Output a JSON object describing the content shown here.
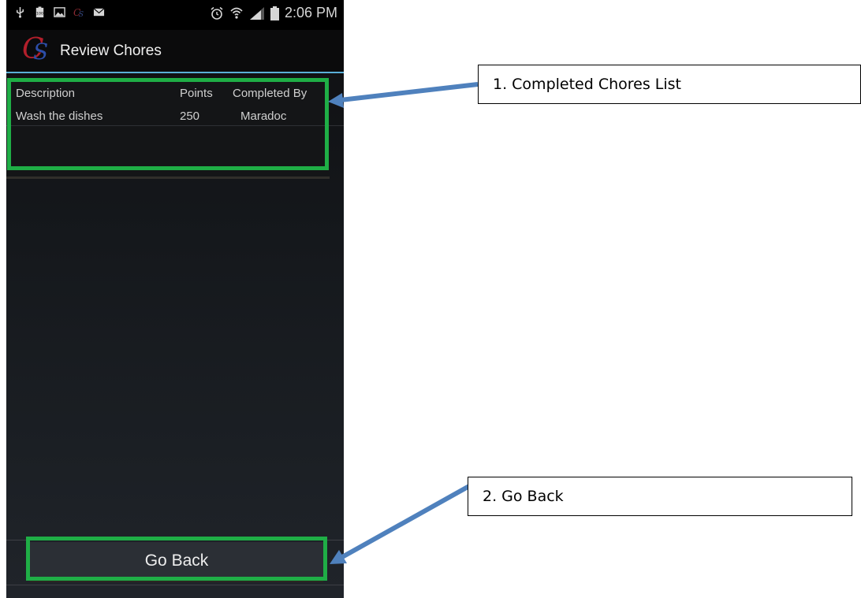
{
  "status_bar": {
    "time": "2:06 PM",
    "left_icons": [
      "usb-icon",
      "battery-100-icon",
      "image-icon",
      "cs-app-icon",
      "email-icon"
    ],
    "right_icons": [
      "alarm-icon",
      "wifi-icon",
      "signal-icon",
      "battery-icon"
    ],
    "battery_badge": "100"
  },
  "action_bar": {
    "logo_c": "C",
    "logo_s": "S",
    "title": "Review Chores",
    "accent_color": "#5ab0d8"
  },
  "chores_list": {
    "columns": [
      "Description",
      "Points",
      "Completed By"
    ],
    "rows": [
      {
        "description": "Wash the dishes",
        "points": "250",
        "completed_by": "Maradoc"
      }
    ]
  },
  "go_back_button": {
    "label": "Go Back"
  },
  "annotations": {
    "highlight_color": "#1fae46",
    "arrow_color": "#4f81bd",
    "callouts": [
      {
        "label": "1. Completed Chores List"
      },
      {
        "label": "2. Go Back"
      }
    ]
  }
}
